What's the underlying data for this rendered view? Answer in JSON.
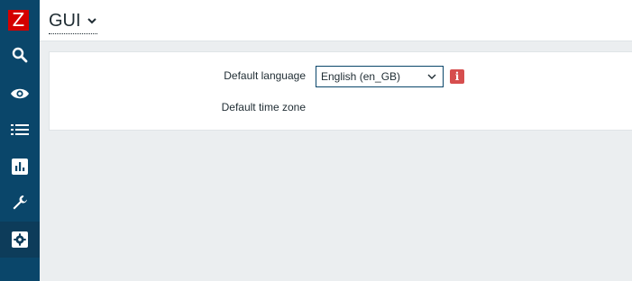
{
  "sidebar": {
    "logo": "Z",
    "items": [
      {
        "name": "search-icon"
      },
      {
        "name": "eye-icon"
      },
      {
        "name": "list-icon"
      },
      {
        "name": "reports-icon"
      },
      {
        "name": "wrench-icon"
      },
      {
        "name": "gear-icon",
        "active": true
      }
    ]
  },
  "header": {
    "title": "GUI"
  },
  "form": {
    "default_language_label": "Default language",
    "default_language_value": "English (en_GB)",
    "default_timezone_label": "Default time zone",
    "info_badge": "i"
  },
  "colors": {
    "sidebar": "#0a466a",
    "accent": "#d40000",
    "info_badge": "#d64e4e",
    "background": "#ebeef0"
  }
}
